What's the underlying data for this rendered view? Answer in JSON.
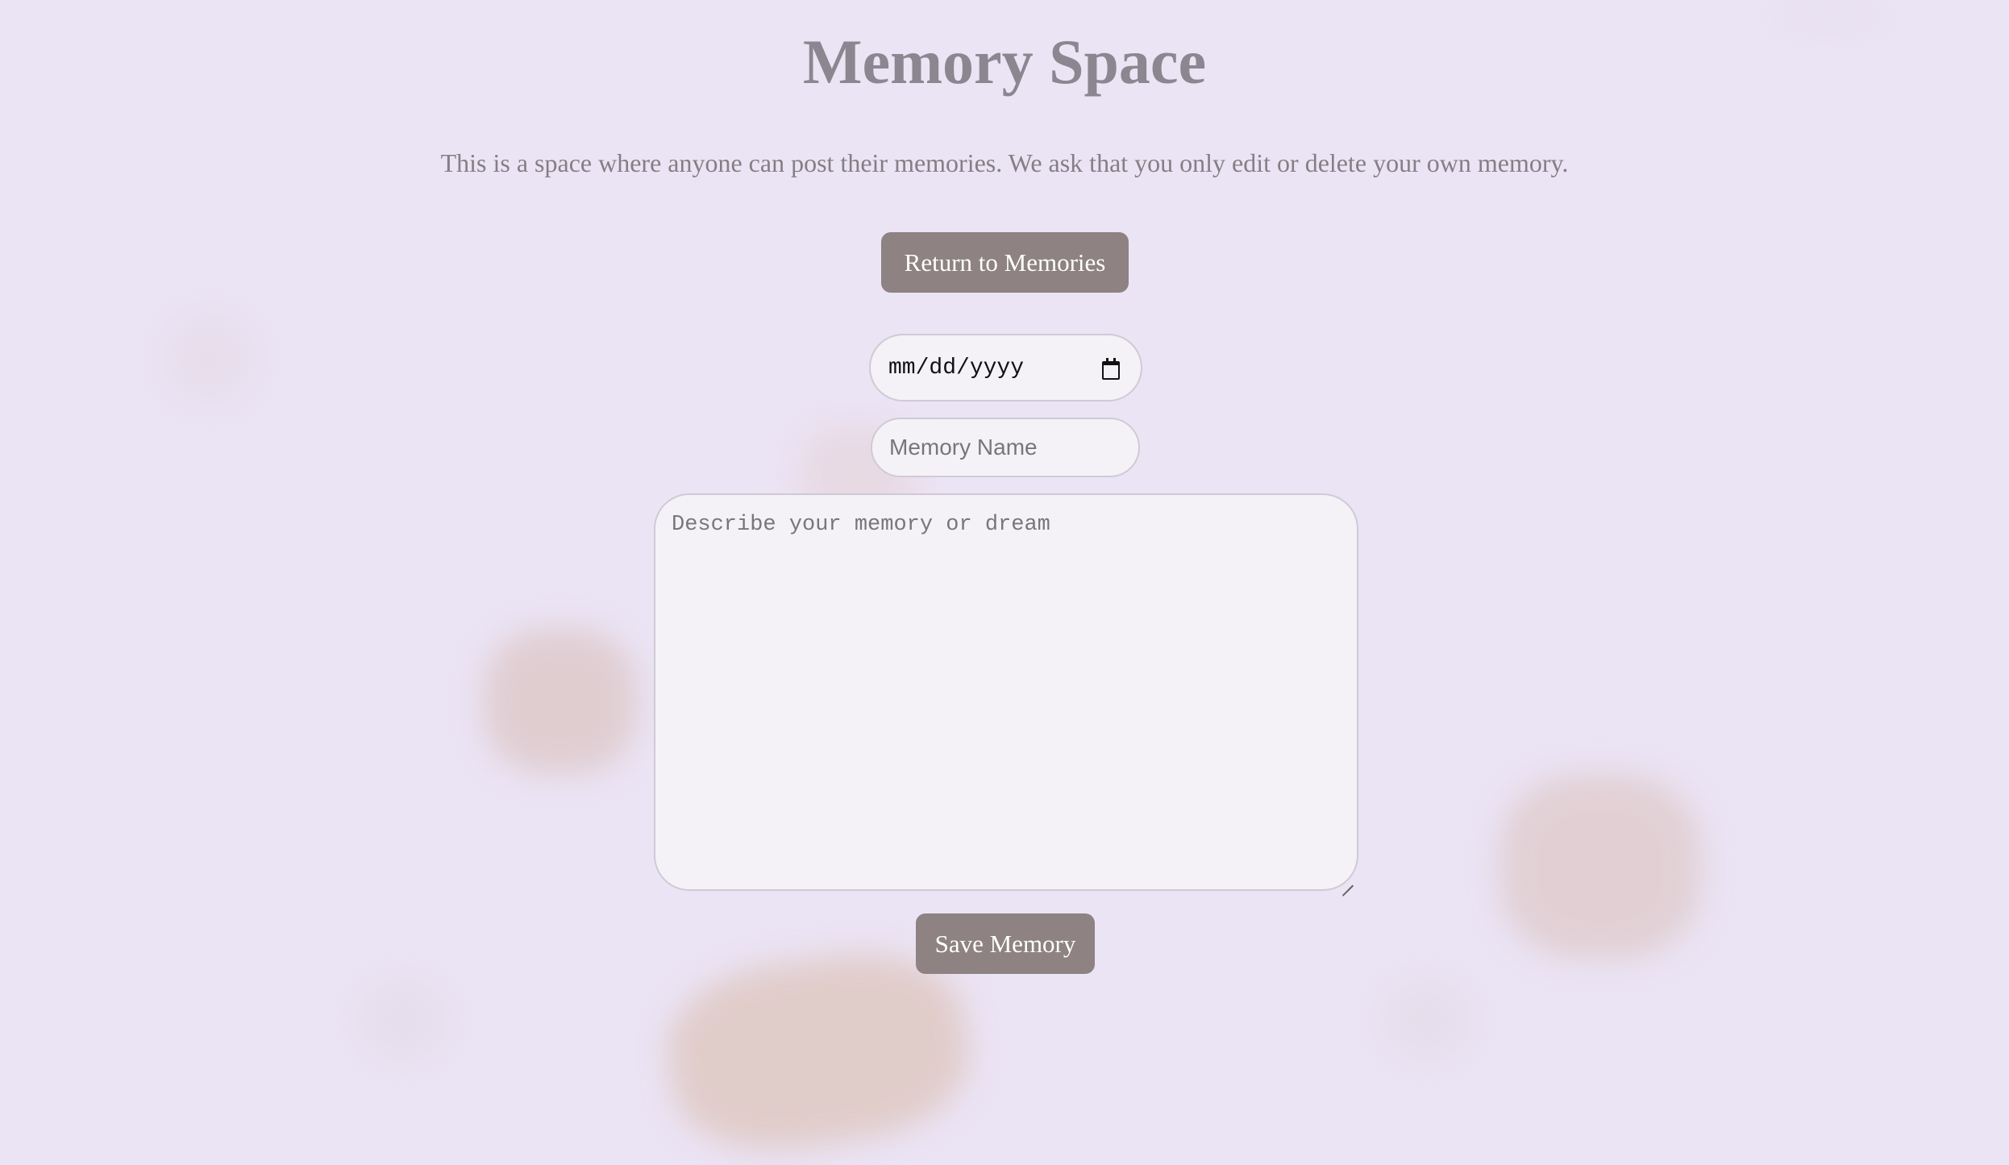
{
  "page": {
    "title": "Memory Space",
    "subtitle": "This is a space where anyone can post their memories. We ask that you only edit or delete your own memory."
  },
  "actions": {
    "return_label": "Return to Memories",
    "save_label": "Save Memory"
  },
  "form": {
    "date_placeholder": "mm/dd/yyyy",
    "name_placeholder": "Memory Name",
    "description_placeholder": "Describe your memory or dream"
  },
  "icons": {
    "date_picker": "calendar-icon",
    "textarea_resize": "resize-grip-icon"
  },
  "colors": {
    "background": "#ebe4f5",
    "button": "#8e8282",
    "title": "#8b8790",
    "field_background": "#f4f2f7"
  }
}
